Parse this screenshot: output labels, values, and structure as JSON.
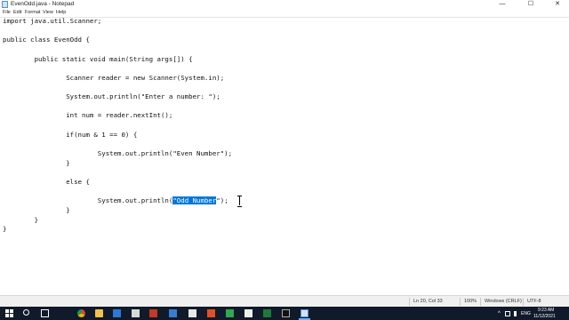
{
  "window": {
    "title": "EvenOdd.java - Notepad",
    "minimize_glyph": "—",
    "maximize_glyph": "☐",
    "close_glyph": "✕"
  },
  "menu": {
    "file": "File",
    "edit": "Edit",
    "format": "Format",
    "view": "View",
    "help": "Help"
  },
  "code": {
    "line1": "import java.util.Scanner;",
    "line2": "public class EvenOdd {",
    "line3": "        public static void main(String args[]) {",
    "line4": "                Scanner reader = new Scanner(System.in);",
    "line5": "                System.out.println(\"Enter a number: \");",
    "line6": "                int num = reader.nextInt();",
    "line7": "                if(num & 1 == 0) {",
    "line8": "                        System.out.println(\"Even Number\");",
    "line9": "                }",
    "line10": "                else {",
    "line11_prefix": "                        System.out.println(",
    "line11_selected": "\"Odd Number",
    "line11_suffix": "\");",
    "line12": "                }",
    "line13": "        }",
    "line14": "}"
  },
  "status": {
    "position": "Ln 20, Col 33",
    "zoom": "100%",
    "line_ending": "Windows (CRLF)",
    "encoding": "UTF-8"
  },
  "taskbar": {
    "language": "ENG",
    "time": "9:23 AM",
    "date": "11/12/2021"
  },
  "colors": {
    "selection": "#0078d7",
    "taskbar": "#101a2a"
  },
  "icons": [
    "notepad-app-icon",
    "windows-start-icon",
    "search-icon",
    "task-view-icon",
    "chrome-icon",
    "file-explorer-icon",
    "network-icon",
    "volume-icon",
    "battery-icon"
  ]
}
